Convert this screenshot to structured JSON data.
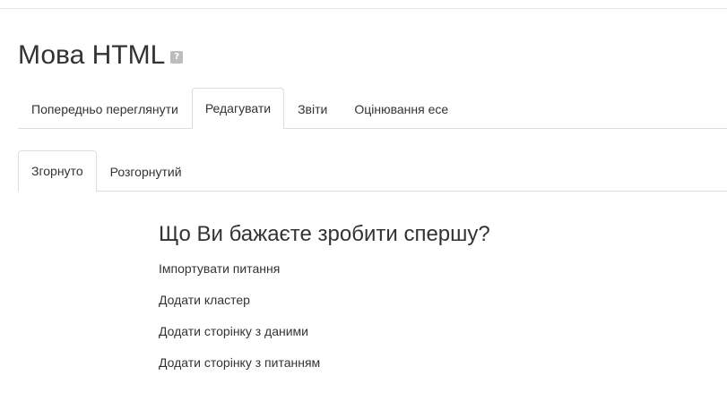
{
  "page": {
    "title": "Мова HTML",
    "help_icon": "help-icon"
  },
  "primary_tabs": [
    {
      "label": "Попередньо переглянути",
      "active": false
    },
    {
      "label": "Редагувати",
      "active": true
    },
    {
      "label": "Звіти",
      "active": false
    },
    {
      "label": "Оцінювання есе",
      "active": false
    }
  ],
  "secondary_tabs": [
    {
      "label": "Згорнуто",
      "active": true
    },
    {
      "label": "Розгорнутий",
      "active": false
    }
  ],
  "prompt": {
    "heading": "Що Ви бажаєте зробити спершу?",
    "actions": [
      {
        "label": "Імпортувати питання"
      },
      {
        "label": "Додати кластер"
      },
      {
        "label": "Додати сторінку з даними"
      },
      {
        "label": "Додати сторінку з питанням"
      }
    ]
  }
}
